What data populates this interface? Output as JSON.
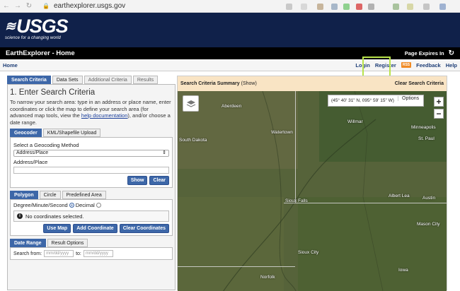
{
  "browser": {
    "url": "earthexplorer.usgs.gov"
  },
  "banner": {
    "logo": "USGS",
    "tagline": "science for a changing world"
  },
  "titlebar": {
    "title": "EarthExplorer - Home",
    "expires": "Page Expires In"
  },
  "nav": {
    "home": "Home",
    "login": "Login",
    "register": "Register",
    "rss": "RSS",
    "feedback": "Feedback",
    "help": "Help"
  },
  "tabs": [
    "Search Criteria",
    "Data Sets",
    "Additional Criteria",
    "Results"
  ],
  "search": {
    "heading": "1. Enter Search Criteria",
    "intro_before": "To narrow your search area: type in an address or place name, enter coordinates or click the map to define your search area (for advanced map tools, view the ",
    "intro_link": "help documentation",
    "intro_after": "), and/or choose a date range.",
    "geo_tabs": [
      "Geocoder",
      "KML/Shapefile Upload"
    ],
    "method_label": "Select a Geocoding Method",
    "method_value": "Address/Place",
    "address_label": "Address/Place",
    "show_btn": "Show",
    "clear_btn": "Clear",
    "shape_tabs": [
      "Polygon",
      "Circle",
      "Predefined Area"
    ],
    "coord_label": "Degree/Minute/Second",
    "decimal_label": "Decimal",
    "no_coords": "No coordinates selected.",
    "use_map": "Use Map",
    "add_coord": "Add Coordinate",
    "clear_coords": "Clear Coordinates",
    "date_tabs": [
      "Date Range",
      "Result Options"
    ],
    "search_from": "Search from:",
    "to": "to:",
    "date_placeholder": "mm/dd/yyyy"
  },
  "map": {
    "summary": "Search Criteria Summary",
    "show": "(Show)",
    "clear": "Clear Search Criteria",
    "coords": "(45° 40' 31\" N, 095° 59' 15\" W)",
    "options": "Options",
    "zoom_in": "+",
    "zoom_out": "−",
    "cities": [
      "Aberdeen",
      "Willmar",
      "Minneapolis",
      "St. Paul",
      "Watertown",
      "South Dakota",
      "Sioux Falls",
      "Albert Lea",
      "Austin",
      "Mason City",
      "Sioux City",
      "Norfolk",
      "Iowa"
    ]
  }
}
